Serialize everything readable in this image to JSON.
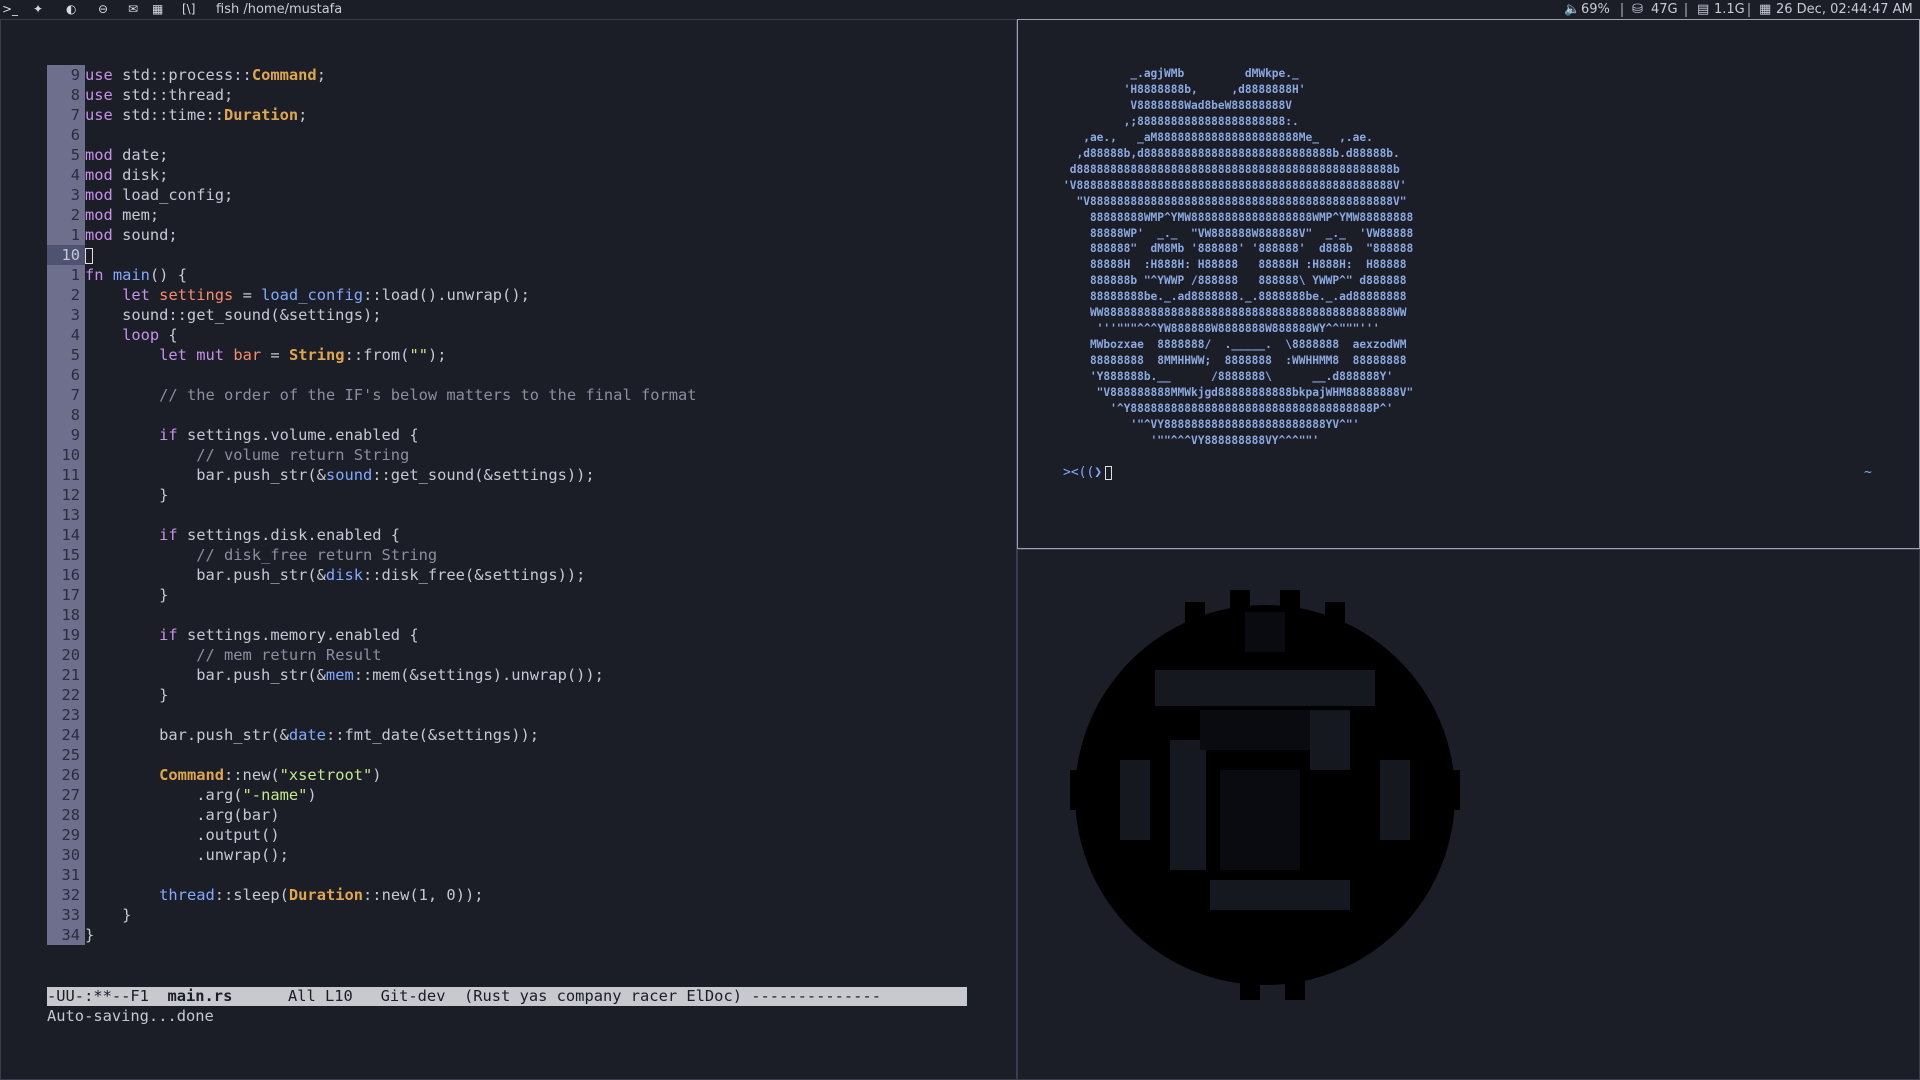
{
  "topbar": {
    "workspace_icons": ">_ ✦ ◐ ⊖ ✉ ▦ [\\]",
    "window_title": "fish /home/mustafa",
    "volume": "69%",
    "disk": "47G",
    "memory": "1.1G",
    "datetime": "26 Dec, 02:44:47 AM"
  },
  "editor": {
    "lines": [
      {
        "n": "9",
        "t": "use std::process::Command;"
      },
      {
        "n": "8",
        "t": "use std::thread;"
      },
      {
        "n": "7",
        "t": "use std::time::Duration;"
      },
      {
        "n": "6",
        "t": ""
      },
      {
        "n": "5",
        "t": "mod date;"
      },
      {
        "n": "4",
        "t": "mod disk;"
      },
      {
        "n": "3",
        "t": "mod load_config;"
      },
      {
        "n": "2",
        "t": "mod mem;"
      },
      {
        "n": "1",
        "t": "mod sound;"
      },
      {
        "n": "10",
        "t": ""
      },
      {
        "n": "1",
        "t": "fn main() {"
      },
      {
        "n": "2",
        "t": "    let settings = load_config::load().unwrap();"
      },
      {
        "n": "3",
        "t": "    sound::get_sound(&settings);"
      },
      {
        "n": "4",
        "t": "    loop {"
      },
      {
        "n": "5",
        "t": "        let mut bar = String::from(\"\");"
      },
      {
        "n": "6",
        "t": ""
      },
      {
        "n": "7",
        "t": "        // the order of the IF's below matters to the final format"
      },
      {
        "n": "8",
        "t": ""
      },
      {
        "n": "9",
        "t": "        if settings.volume.enabled {"
      },
      {
        "n": "10",
        "t": "            // volume return String"
      },
      {
        "n": "11",
        "t": "            bar.push_str(&sound::get_sound(&settings));"
      },
      {
        "n": "12",
        "t": "        }"
      },
      {
        "n": "13",
        "t": ""
      },
      {
        "n": "14",
        "t": "        if settings.disk.enabled {"
      },
      {
        "n": "15",
        "t": "            // disk_free return String"
      },
      {
        "n": "16",
        "t": "            bar.push_str(&disk::disk_free(&settings));"
      },
      {
        "n": "17",
        "t": "        }"
      },
      {
        "n": "18",
        "t": ""
      },
      {
        "n": "19",
        "t": "        if settings.memory.enabled {"
      },
      {
        "n": "20",
        "t": "            // mem return Result"
      },
      {
        "n": "21",
        "t": "            bar.push_str(&mem::mem(&settings).unwrap());"
      },
      {
        "n": "22",
        "t": "        }"
      },
      {
        "n": "23",
        "t": ""
      },
      {
        "n": "24",
        "t": "        bar.push_str(&date::fmt_date(&settings));"
      },
      {
        "n": "25",
        "t": ""
      },
      {
        "n": "26",
        "t": "        Command::new(\"xsetroot\")"
      },
      {
        "n": "27",
        "t": "            .arg(\"-name\")"
      },
      {
        "n": "28",
        "t": "            .arg(bar)"
      },
      {
        "n": "29",
        "t": "            .output()"
      },
      {
        "n": "30",
        "t": "            .unwrap();"
      },
      {
        "n": "31",
        "t": ""
      },
      {
        "n": "32",
        "t": "        thread::sleep(Duration::new(1, 0));"
      },
      {
        "n": "33",
        "t": "    }"
      },
      {
        "n": "34",
        "t": "}"
      }
    ],
    "current_line_index": 9,
    "modeline": {
      "status": "-UU-:**--F1  ",
      "buffer": "main.rs",
      "rest": "      All L10   Git-dev  (Rust yas company racer ElDoc) --------------"
    },
    "echo": "Auto-saving...done"
  },
  "terminal": {
    "ascii_art": "          _.agjWMb         dMWkpe._\n         'H8888888b,     ,d8888888H'\n          V8888888Wad8beW88888888V\n         ,;8888888888888888888888:.\n   ,ae.,   _aM888888888888888888888Me_   ,.ae.\n  ,d88888b,d8888888888888888888888888888b.d88888b.\n d88888888888888888888888888888888888888888888888b\n'V88888888888888888888888888888888888888888888888V'\n  \"V888888888888888888888888888888888888888888888V\"\n    88888888WMP^YMW888888888888888888WMP^YMW88888888\n    88888WP'  _._  \"VW888888W888888V\"  _._  'VW88888\n    888888\"  dM8Mb '888888' '888888'  d888b  \"888888\n    88888H  :H888H: H88888   88888H :H888H:  H88888\n    888888b \"^YWWP /888888   888888\\ YWWP^\" d888888\n    88888888be._.ad8888888._.8888888be._.ad88888888\n    WW8888888888888888888888888888888888888888888WW\n     '''\"\"\"^^^YW888888W8888888W888888WY^^\"\"\"'''\n    MWbozxae  8888888/  ._____.  \\8888888  aexzodWM\n    88888888  8MMHHWW;  8888888  :WWHHMM8  88888888\n    'Y888888b.__      /8888888\\      __.d888888Y'\n     \"V888888888MMWkjgd88888888888bkpajWHM88888888V\"\n       '^Y888888888888888888888888888888888888P^'\n          '\"^VY888888888888888888888888YV^\"'\n             '\"\"^^^VY888888888VY^^^\"\"'",
    "prompt": "><((❯",
    "right_prompt": "~"
  },
  "image_pane": {
    "logo": "pixelated-rust-logo"
  }
}
